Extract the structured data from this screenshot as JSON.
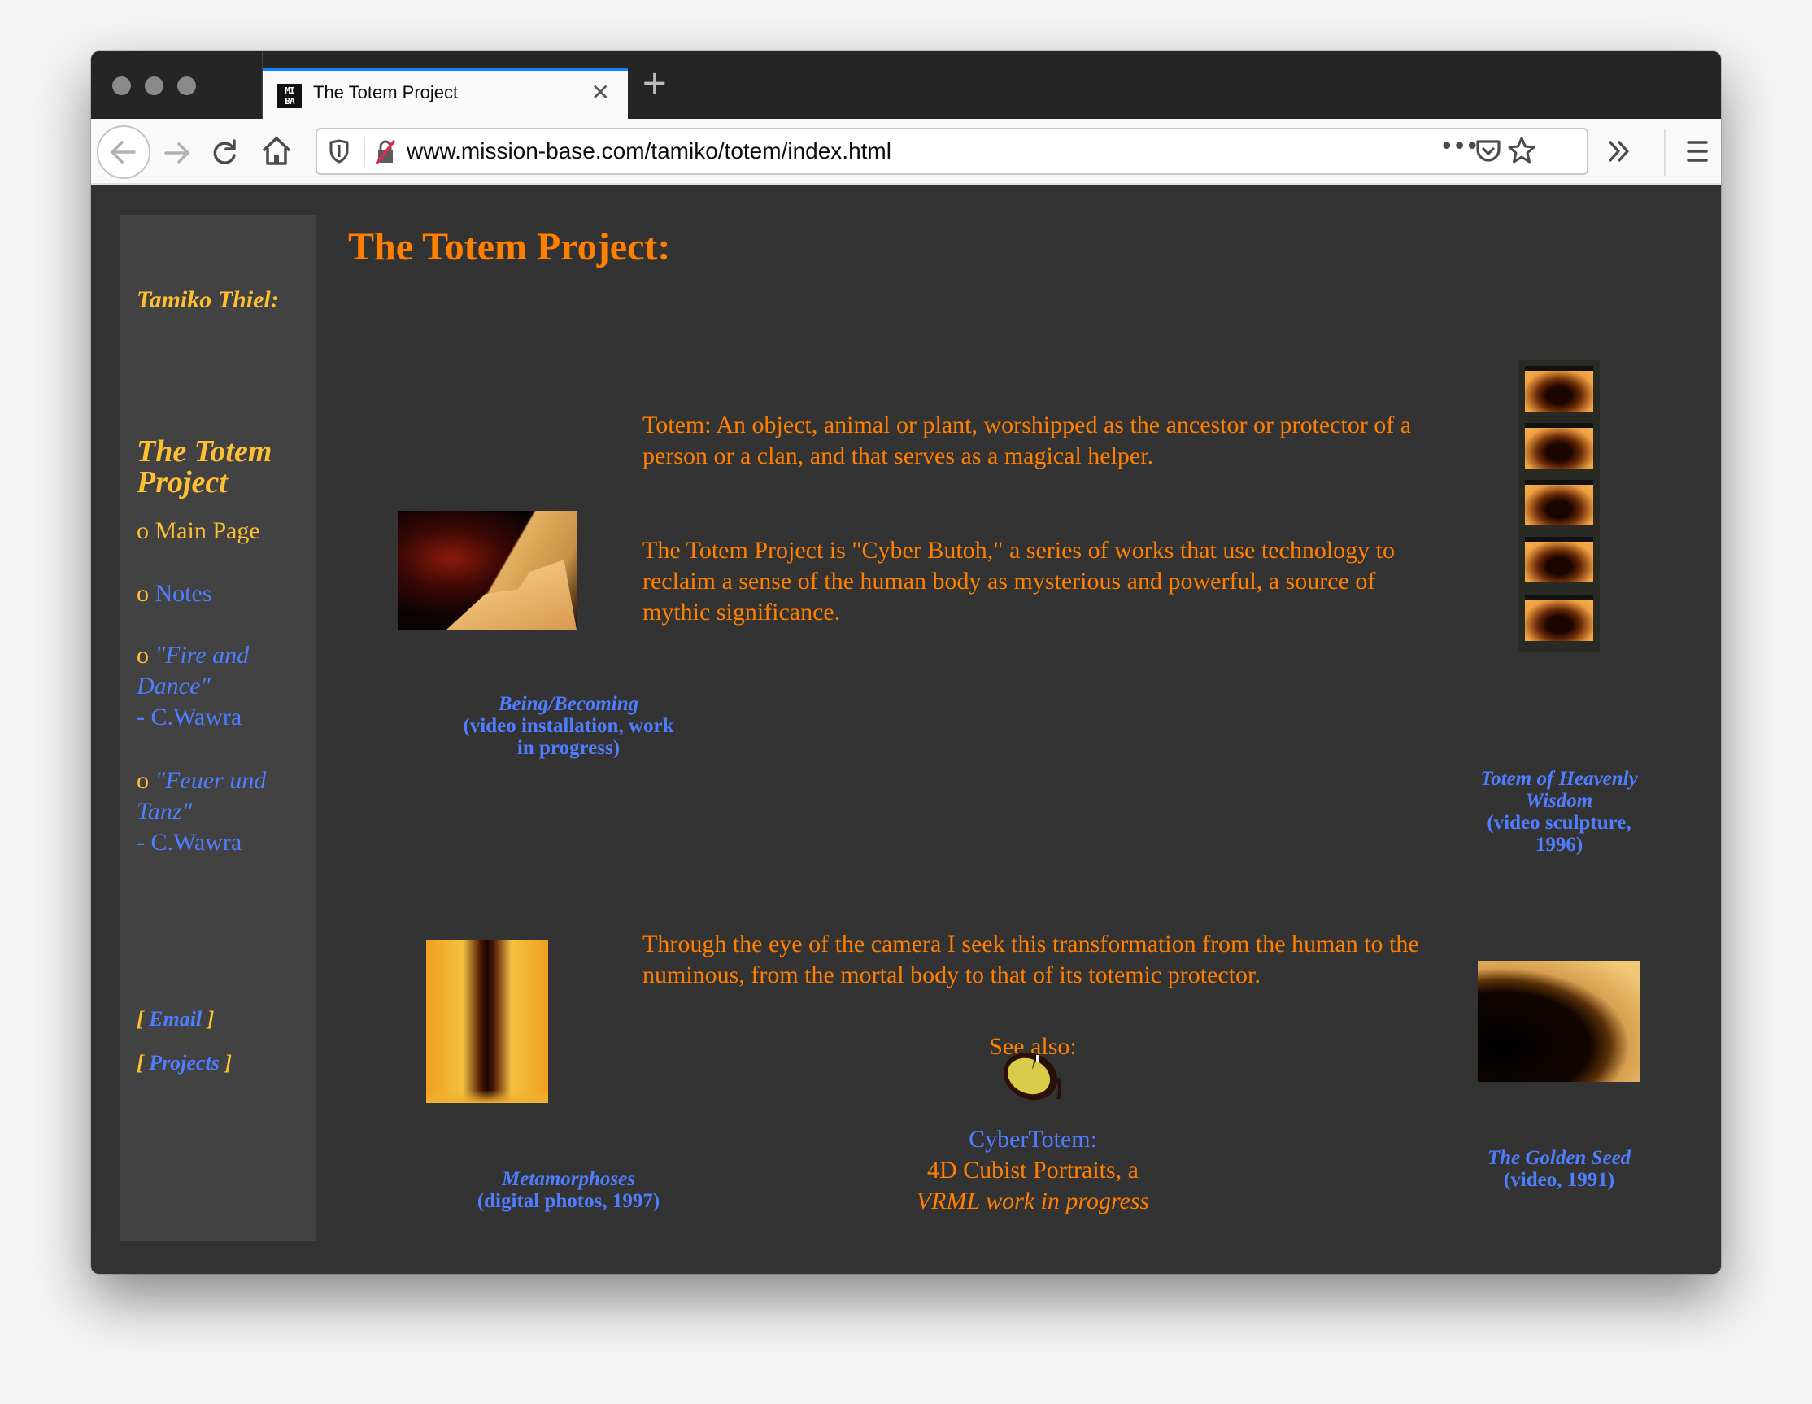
{
  "browser": {
    "tab_title": "The Totem Project",
    "favicon_text": "MI BA",
    "url": "www.mission-base.com/tamiko/totem/index.html",
    "icons": [
      "back-arrow-icon",
      "forward-arrow-icon",
      "reload-icon",
      "home-icon",
      "tracking-shield-icon",
      "insecure-lock-icon",
      "page-actions-icon",
      "pocket-icon",
      "bookmark-star-icon",
      "overflow-chevron-icon",
      "hamburger-menu-icon"
    ]
  },
  "sidebar": {
    "author": "Tamiko Thiel:",
    "section_title_line1": "The Totem",
    "section_title_line2": "Project",
    "bullet": "o",
    "items": [
      {
        "label": "Main Page",
        "active": true
      },
      {
        "label": "Notes"
      },
      {
        "label_line1": "\"Fire and",
        "label_line2": "Dance\"",
        "label_line3": "- C.Wawra"
      },
      {
        "label_line1": "\"Feuer und",
        "label_line2": "Tanz\"",
        "label_line3": "- C.Wawra"
      }
    ],
    "email_link": "Email",
    "projects_link": "Projects",
    "bracket_open": "[",
    "bracket_close": "]"
  },
  "main": {
    "heading": "The Totem Project:",
    "paragraphs": [
      "Totem: An object, animal or plant, worshipped as the ancestor or protector of a person or a clan, and that serves as a magical helper.",
      "The Totem Project is \"Cyber Butoh,\" a series of works that use technology to reclaim a sense of the human body as mysterious and powerful, a source of mythic significance.",
      "Through the eye of the camera I seek this transformation from the human to the numinous, from the mortal body to that of its totemic protector."
    ],
    "see_also": {
      "label": "See also:",
      "link": "CyberTotem:",
      "line2": "4D Cubist Portraits, a",
      "line3": "VRML work in progress"
    },
    "works": [
      {
        "title": "Being/Becoming",
        "detail_line1": "(video installation, work",
        "detail_line2": "in progress)"
      },
      {
        "title_line1": "Totem of Heavenly",
        "title_line2": "Wisdom",
        "detail_line1": "(video sculpture,",
        "detail_line2": "1996)"
      },
      {
        "title": "Metamorphoses",
        "detail": "(digital photos, 1997)"
      },
      {
        "title": "The Golden Seed",
        "detail": "(video, 1991)"
      }
    ]
  },
  "colors": {
    "accent_orange": "#ff7f00",
    "link_blue": "#4f7dff",
    "sidebar_yellow": "#ffbf33",
    "page_bg": "#333333",
    "sidebar_bg": "#424242",
    "tab_accent": "#0a84ff"
  }
}
